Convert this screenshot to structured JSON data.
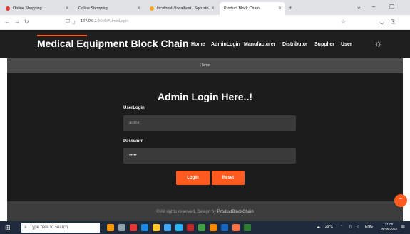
{
  "browser": {
    "tabs": [
      {
        "label": "Online Shopping",
        "active": false
      },
      {
        "label": "Online Shopping",
        "active": false
      },
      {
        "label": "localhost / localhost / Sqcusto",
        "active": false
      },
      {
        "label": "Product Block Chain",
        "active": true
      }
    ],
    "new_tab": "+",
    "url_host": "127.0.0.1",
    "url_path": ":5000/AdminLogin"
  },
  "header": {
    "brand": "Medical Equipment Block Chain",
    "menu": [
      "Home",
      "AdminLogin",
      "Manufacturer",
      "Distributor",
      "Supplier",
      "User"
    ]
  },
  "breadcrumb": "Home",
  "form": {
    "title": "Admin Login Here..!",
    "user_label": "UserLogin",
    "user_placeholder": "admin",
    "password_label": "Password",
    "password_value": "•••••",
    "login_label": "Login",
    "reset_label": "Reset"
  },
  "footer": {
    "text": "© All rights reserved. Design by ",
    "brand": "ProductBlockChain"
  },
  "taskbar": {
    "search_placeholder": "Type here to search",
    "weather": "29°C",
    "lang": "ENG",
    "time": "21:08",
    "date": "06-06-2023"
  },
  "colors": {
    "accent": "#ff5a1f",
    "header_bg": "#1f1f1f",
    "main_bg": "#1c1c1c"
  }
}
